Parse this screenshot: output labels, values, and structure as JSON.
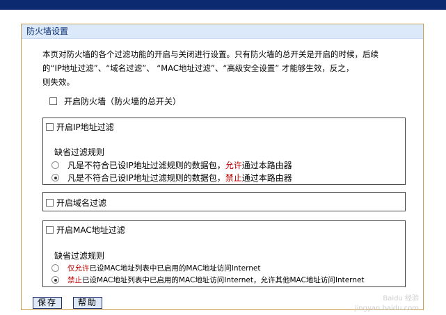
{
  "panel": {
    "title": "防火墙设置",
    "intro_line1": "本页对防火墙的各个过滤功能的开启与关闭进行设置。只有防火墙的总开关是开启的时候，后续",
    "intro_line2": "的“IP地址过滤”、“域名过滤”、 “MAC地址过滤”、“高级安全设置” 才能够生效，反之，",
    "intro_line3": "则失效。"
  },
  "master_switch": {
    "label": "开启防火墙（防火墙的总开关）",
    "checked": false
  },
  "ip_filter": {
    "label": "开启IP地址过滤",
    "checked": false,
    "rule_title": "缺省过滤规则",
    "option1_a": "凡是不符合已设IP地址过滤规则的数据包，",
    "option1_b": "允许",
    "option1_c": "通过本路由器",
    "option2_a": "凡是不符合已设IP地址过滤规则的数据包，",
    "option2_b": "禁止",
    "option2_c": "通过本路由器",
    "selected": 2
  },
  "domain_filter": {
    "label": "开启域名过滤",
    "checked": false
  },
  "mac_filter": {
    "label": "开启MAC地址过滤",
    "checked": false,
    "rule_title": "缺省过滤规则",
    "option1_a": "仅允许",
    "option1_b": "已设MAC地址列表中已启用的MAC地址访问Internet",
    "option2_a": "禁止",
    "option2_b": "已设MAC地址列表中已启用的MAC地址访问Internet，允许其他MAC地址访问Internet",
    "selected": 2
  },
  "buttons": {
    "save": "保存",
    "help": "帮助"
  },
  "watermark": {
    "line1": "Baidu 经验",
    "line2": "jingyan.baidu.com"
  },
  "colors": {
    "header_bg": "#dce9fb",
    "top_bar": "#0b2a6f",
    "panel_border": "#c9a04b",
    "highlight": "#c00000"
  }
}
